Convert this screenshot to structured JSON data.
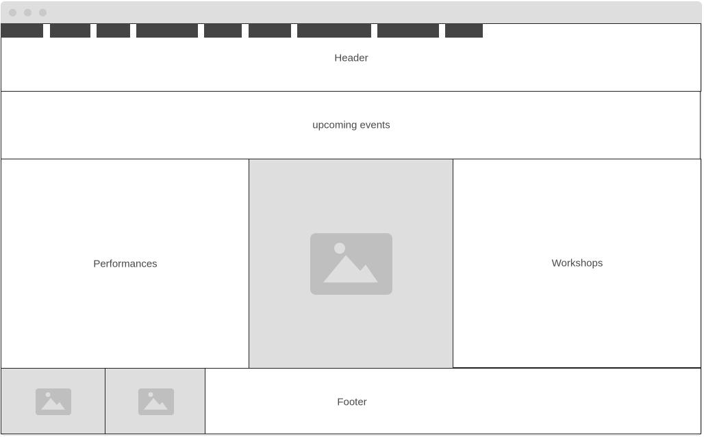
{
  "window": {
    "controls": [
      "close-dot",
      "minimize-dot",
      "maximize-dot"
    ]
  },
  "nav": {
    "tabs": [
      "",
      "",
      "",
      "",
      "",
      "",
      "",
      "",
      ""
    ]
  },
  "sections": {
    "header": "Header",
    "upcoming_events": "upcoming events",
    "performances": "Performances",
    "workshops": "Workshops",
    "footer": "Footer"
  },
  "images": {
    "hero": "image-placeholder-icon",
    "footer_left": "image-placeholder-icon",
    "footer_right": "image-placeholder-icon"
  }
}
